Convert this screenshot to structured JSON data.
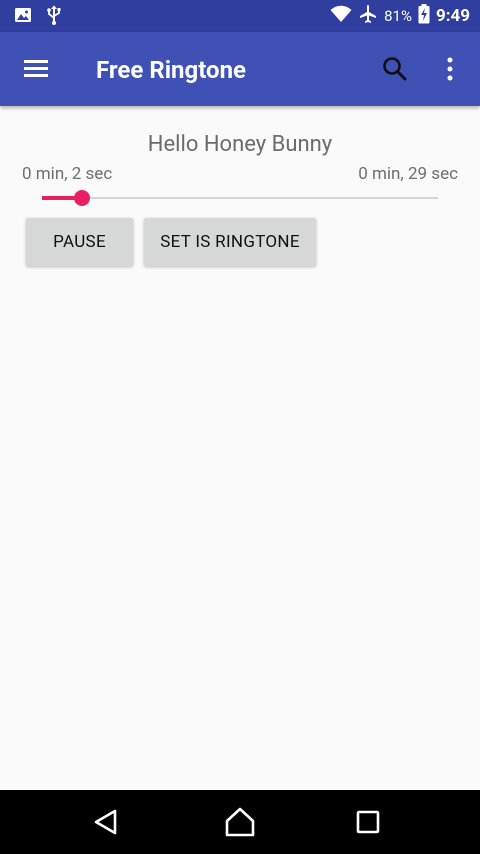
{
  "status_bar": {
    "battery_percent": "81%",
    "time": "9:49",
    "icons": [
      "image-icon",
      "usb-icon",
      "wifi-icon",
      "airplane-icon",
      "battery-charging-icon"
    ]
  },
  "app_bar": {
    "title": "Free Ringtone",
    "icons": [
      "menu-icon",
      "search-icon",
      "more-vert-icon"
    ]
  },
  "player": {
    "song_title": "Hello Honey Bunny",
    "current_time": "0 min, 2 sec",
    "total_time": "0 min, 29 sec",
    "progress_fraction": 0.1,
    "accent_color": "#e91e63"
  },
  "buttons": {
    "pause_label": "PAUSE",
    "set_ringtone_label": "SET IS RINGTONE"
  },
  "nav_bar": {
    "icons": [
      "back-icon",
      "home-icon",
      "recent-apps-icon"
    ]
  },
  "colors": {
    "primary": "#3f51b5",
    "primary_dark": "#303f9f",
    "button_bg": "#d6d7d7"
  }
}
